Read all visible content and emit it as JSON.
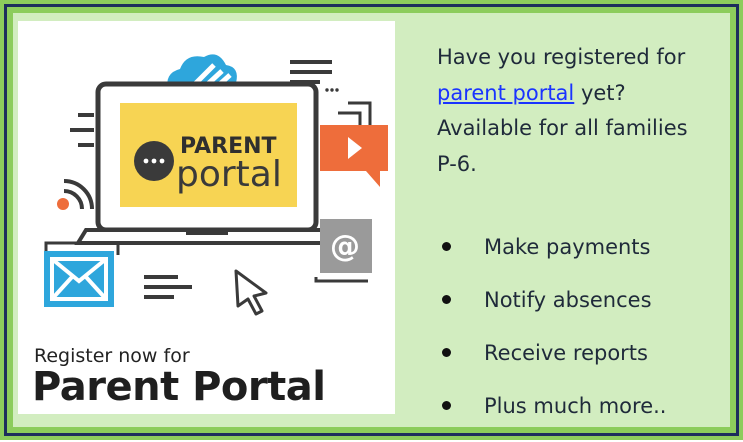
{
  "promo": {
    "screen_line1": "PARENT",
    "screen_line2": "portal",
    "register_small": "Register now for",
    "register_big": "Parent Portal",
    "at_symbol": "@",
    "icons": [
      "cloud-icon",
      "text-lines-icon",
      "rss-icon",
      "video-play-icon",
      "envelope-icon",
      "at-sign-icon",
      "cursor-arrow-icon",
      "speech-dots-icon"
    ]
  },
  "intro": {
    "line1": "Have you registered for",
    "link_text": "parent portal",
    "link_after": " yet?",
    "line3": "Available for all families",
    "line4": "P-6."
  },
  "bullets": [
    {
      "label": "Make payments"
    },
    {
      "label": "Notify absences"
    },
    {
      "label": "Receive reports"
    },
    {
      "label": "Plus much more.."
    }
  ],
  "colors": {
    "outer_green": "#8ccc5c",
    "border_navy": "#1c2d5c",
    "panel_green": "#d2edc0",
    "screen_yellow": "#f7d453",
    "accent_orange": "#ee6d3b",
    "accent_blue": "#2ea6dc",
    "link_blue": "#1a33ff"
  }
}
